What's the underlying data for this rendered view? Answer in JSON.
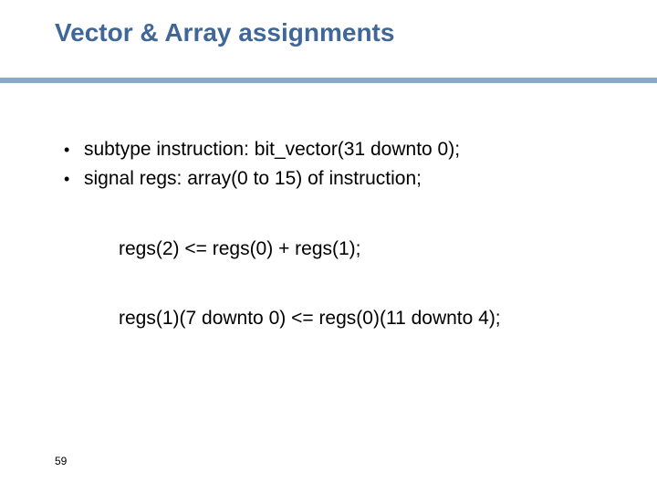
{
  "title": "Vector & Array assignments",
  "bullets": [
    "subtype  instruction: bit_vector(31 downto 0);",
    "signal  regs: array(0 to 15) of instruction;"
  ],
  "code": [
    "regs(2) <= regs(0) + regs(1);",
    "regs(1)(7 downto 0) <= regs(0)(11 downto 4);"
  ],
  "page_number": "59"
}
